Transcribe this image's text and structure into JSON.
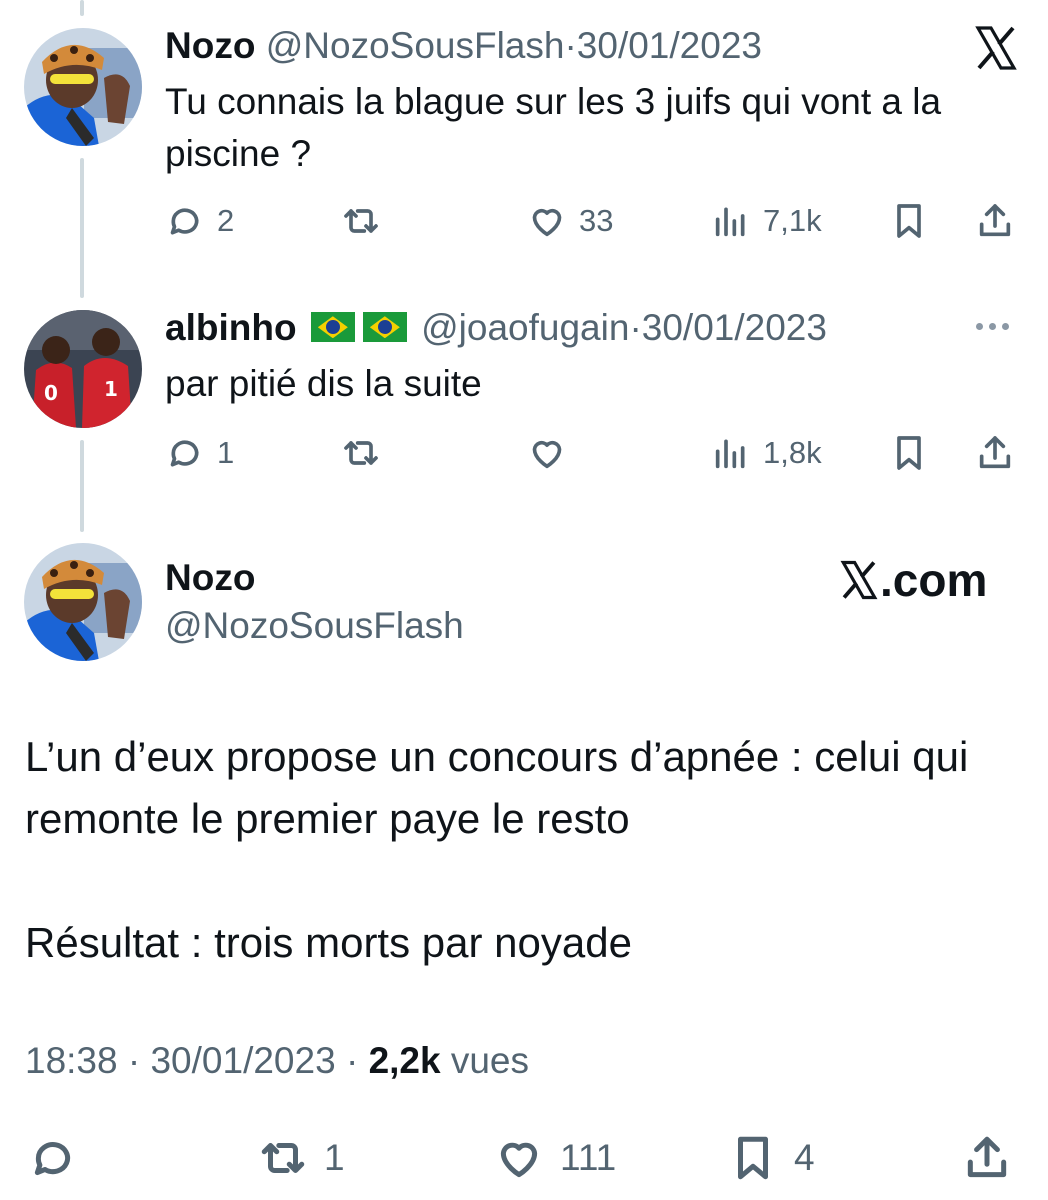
{
  "tweets": [
    {
      "name": "Nozo",
      "handle": "@NozoSousFlash",
      "sep": "·",
      "date": "30/01/2023",
      "text": "Tu connais la blague sur les 3 juifs qui vont a la piscine ?",
      "replies": "2",
      "retweets": "",
      "likes": "33",
      "views": "7,1k"
    },
    {
      "name": "albinho",
      "flags": [
        "brazil-flag",
        "brazil-flag"
      ],
      "handle": "@joaofugain",
      "sep": "·",
      "date": "30/01/2023",
      "text": "par pitié dis la suite",
      "replies": "1",
      "retweets": "",
      "likes": "",
      "views": "1,8k"
    }
  ],
  "main": {
    "name": "Nozo",
    "handle": "@NozoSousFlash",
    "watermark": ".com",
    "text1": "L’un d’eux propose un concours d’apnée : celui qui remonte le premier paye le resto",
    "text2": "Résultat : trois morts par noyade",
    "time": "18:38",
    "sep": "·",
    "date": "30/01/2023",
    "views_count": "2,2k",
    "views_label": "vues",
    "retweets": "1",
    "likes": "111",
    "bookmarks": "4"
  },
  "icons": {
    "reply": "reply-icon",
    "retweet": "retweet-icon",
    "like": "heart-icon",
    "views": "views-icon",
    "bookmark": "bookmark-icon",
    "share": "share-icon",
    "more": "more-icon",
    "x_logo": "x-logo-icon"
  },
  "colors": {
    "text": "#0f1419",
    "muted": "#536471",
    "thread_line": "#cfd9de"
  }
}
